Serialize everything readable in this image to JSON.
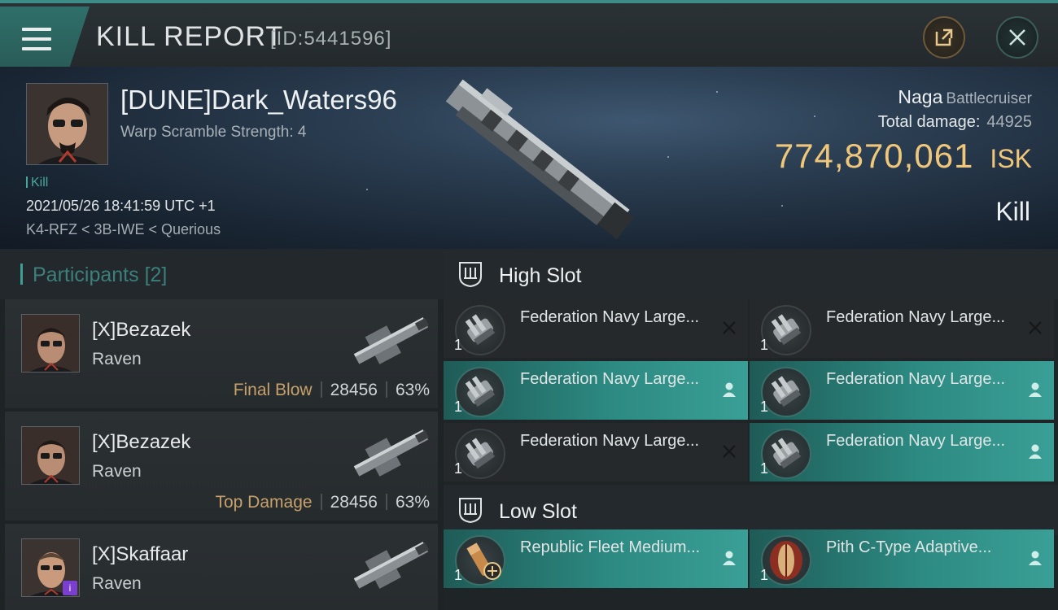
{
  "header": {
    "title": "KILL REPORT",
    "report_id": "[ID:5441596]",
    "menu_icon": "hamburger-icon",
    "share_icon": "external-link-icon",
    "close_icon": "close-icon",
    "accent_color": "#3c8d87"
  },
  "victim": {
    "name": "[DUNE]Dark_Waters96",
    "warp": "Warp Scramble Strength: 4",
    "kill_tag": "Kill",
    "datetime": "2021/05/26 18:41:59 UTC +1",
    "location": "K4-RFZ < 3B-IWE < Querious",
    "ship_name": "Naga",
    "ship_class": "Battlecruiser",
    "total_damage_label": "Total damage:",
    "total_damage": "44925",
    "isk_value": "774,870,061",
    "isk_unit": "ISK",
    "result_label": "Kill",
    "isk_color": "#f0c77a"
  },
  "participants": {
    "title": "Participants",
    "count": "[2]",
    "items": [
      {
        "name": "[X]Bezazek",
        "ship": "Raven",
        "tag": "Final Blow",
        "damage": "28456",
        "percent": "63%"
      },
      {
        "name": "[X]Bezazek",
        "ship": "Raven",
        "tag": "Top Damage",
        "damage": "28456",
        "percent": "63%"
      },
      {
        "name": "[X]Skaffaar",
        "ship": "Raven",
        "badge": "i"
      }
    ]
  },
  "fittings": {
    "high_slot": {
      "label": "High Slot",
      "modules": [
        {
          "name": "Federation Navy Large...",
          "qty": "1",
          "status": "destroyed"
        },
        {
          "name": "Federation Navy Large...",
          "qty": "1",
          "status": "destroyed"
        },
        {
          "name": "Federation Navy Large...",
          "qty": "1",
          "status": "dropped"
        },
        {
          "name": "Federation Navy Large...",
          "qty": "1",
          "status": "dropped"
        },
        {
          "name": "Federation Navy Large...",
          "qty": "1",
          "status": "destroyed"
        },
        {
          "name": "Federation Navy Large...",
          "qty": "1",
          "status": "dropped"
        }
      ]
    },
    "low_slot": {
      "label": "Low Slot",
      "modules": [
        {
          "name": "Republic Fleet Medium...",
          "qty": "1",
          "status": "dropped"
        },
        {
          "name": "Pith C-Type Adaptive...",
          "qty": "1",
          "status": "dropped"
        }
      ]
    },
    "dropped_color": "#2c8a82"
  }
}
